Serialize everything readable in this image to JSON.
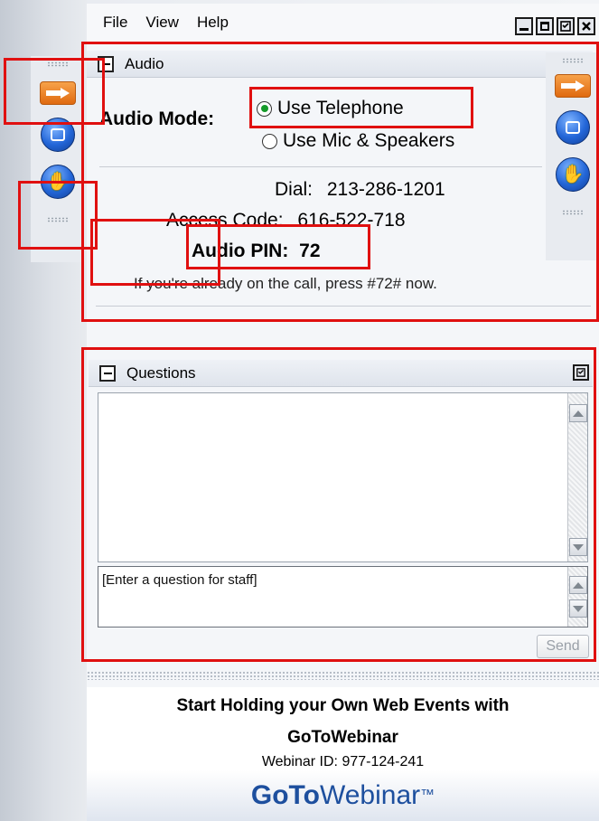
{
  "menu": {
    "items": [
      "File",
      "View",
      "Help"
    ]
  },
  "window_controls": {
    "minimize": "minimize-icon",
    "maximize": "maximize-icon",
    "restore": "restore-icon",
    "close": "close-icon"
  },
  "audio": {
    "title": "Audio",
    "mode_label": "Audio Mode:",
    "options": [
      {
        "label": "Use Telephone",
        "selected": true
      },
      {
        "label": "Use Mic & Speakers",
        "selected": false
      }
    ],
    "dial_label": "Dial:",
    "dial_number": "213-286-1201",
    "access_label": "Access Code:",
    "access_code": "616-522-718",
    "pin_label": "Audio PIN:",
    "pin_value": "72",
    "hint": "If you're already on the call, press #72# now."
  },
  "toolbar": {
    "items": [
      "arrow-icon",
      "screen-icon",
      "raise-hand-icon"
    ]
  },
  "questions": {
    "title": "Questions",
    "placeholder": "[Enter a question for staff]",
    "send_label": "Send"
  },
  "promo": {
    "line1": "Start Holding your Own Web Events with",
    "line2": "GoToWebinar",
    "webinar_id": "Webinar ID: 977-124-241",
    "brand_goto": "GoTo",
    "brand_webinar": "Webinar",
    "brand_tm": "™"
  },
  "colors": {
    "highlight": "#e01010",
    "brand": "#1d4f9e",
    "radio_selected": "#169b2a"
  }
}
